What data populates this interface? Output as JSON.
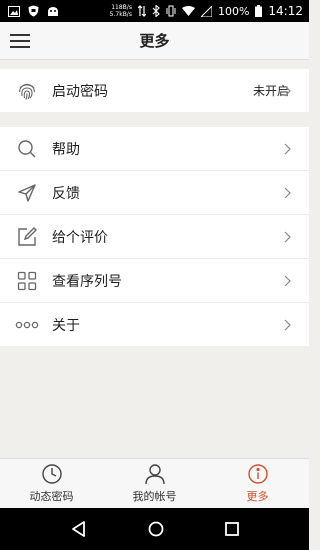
{
  "status_bar": {
    "net_speed_up": "118B/s",
    "net_speed_down": "5.7kB/s",
    "battery": "100%",
    "time": "14:12"
  },
  "header": {
    "title": "更多",
    "menu_icon": "hamburger-menu-icon"
  },
  "security_section": {
    "items": [
      {
        "label": "启动密码",
        "value": "未开启",
        "icon": "fingerprint-icon"
      }
    ]
  },
  "menu_section": {
    "items": [
      {
        "label": "帮助",
        "icon": "search-icon"
      },
      {
        "label": "反馈",
        "icon": "send-icon"
      },
      {
        "label": "给个评价",
        "icon": "edit-icon"
      },
      {
        "label": "查看序列号",
        "icon": "grid-icon"
      },
      {
        "label": "关于",
        "icon": "more-dots-icon"
      }
    ]
  },
  "tab_bar": {
    "tabs": [
      {
        "label": "动态密码",
        "icon": "clock-icon",
        "active": false
      },
      {
        "label": "我的帐号",
        "icon": "user-icon",
        "active": false
      },
      {
        "label": "更多",
        "icon": "info-icon",
        "active": true
      }
    ],
    "active_color": "#d5502c"
  },
  "nav_bar": {
    "buttons": [
      "back-icon",
      "home-icon",
      "recents-icon"
    ]
  }
}
